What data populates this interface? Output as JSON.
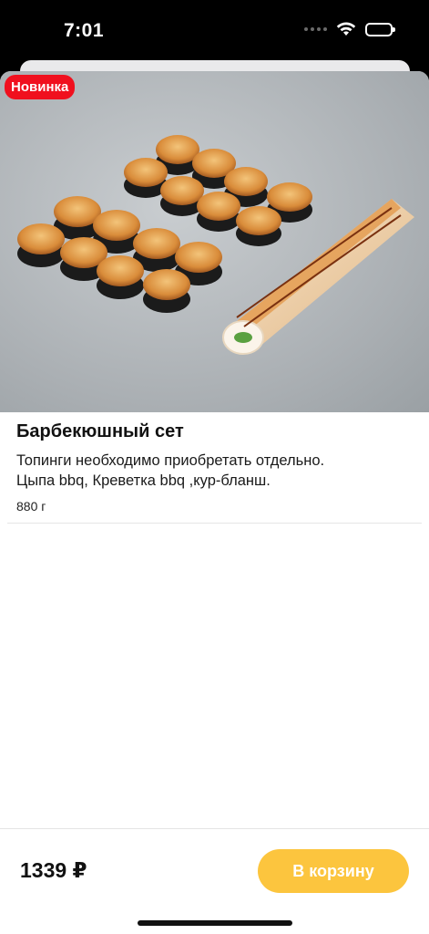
{
  "status_bar": {
    "time": "7:01",
    "icons": [
      "signal-icon",
      "wifi-icon",
      "battery-icon"
    ]
  },
  "product": {
    "badge": "Новинка",
    "image": "sushi-set-photo",
    "title": "Барбекюшный сет",
    "description_lines": [
      "Топинги необходимо приобретать отдельно.",
      "Цыпа bbq, Креветка bbq ,кур-бланш."
    ],
    "weight": "880 г"
  },
  "footer": {
    "price": "1339 ₽",
    "cart_button_label": "В корзину"
  },
  "colors": {
    "badge": "#f0101e",
    "cart_button": "#fcc53e",
    "background": "#ffffff"
  }
}
